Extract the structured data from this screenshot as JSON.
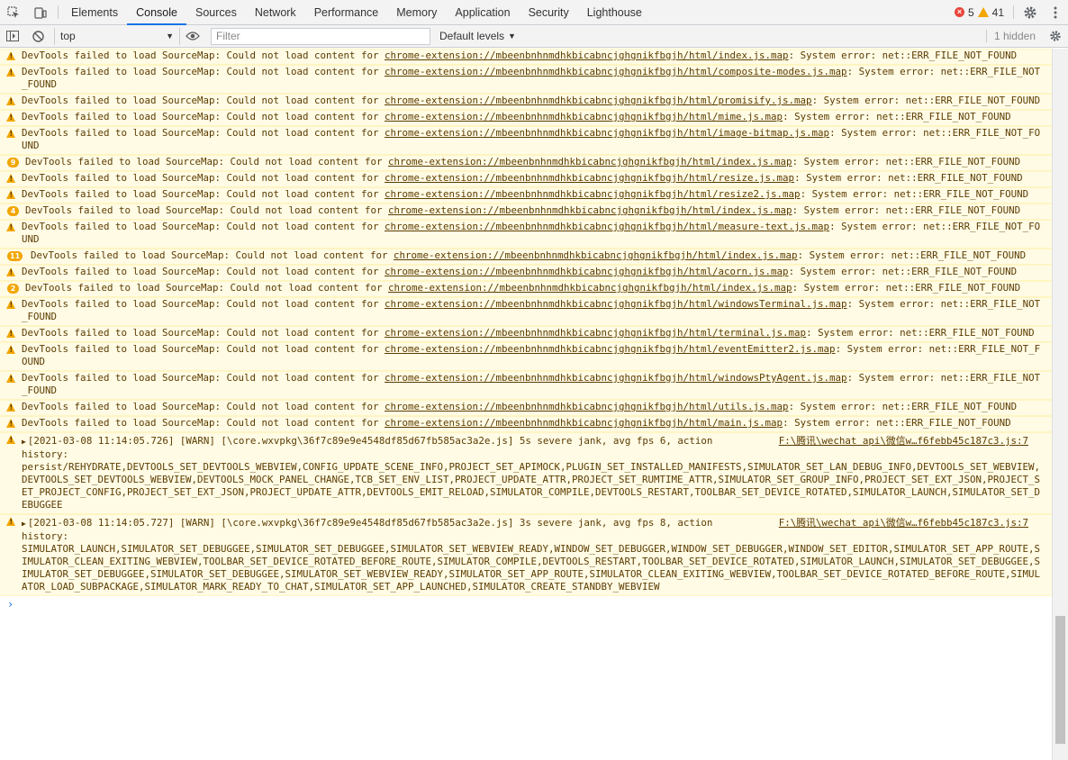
{
  "tabs": [
    "Elements",
    "Console",
    "Sources",
    "Network",
    "Performance",
    "Memory",
    "Application",
    "Security",
    "Lighthouse"
  ],
  "active_tab": "Console",
  "counts": {
    "errors": "5",
    "warnings": "41"
  },
  "toolbar": {
    "context": "top",
    "filter_placeholder": "Filter",
    "levels": "Default levels",
    "hidden": "1 hidden"
  },
  "messages": [
    {
      "badge": "",
      "text": "DevTools failed to load SourceMap: Could not load content for ",
      "link": "chrome-extension://mbeenbnhnmdhkbicabncjghgnikfbgjh/html/index.js.map",
      "tail": ": System error: net::ERR_FILE_NOT_FOUND"
    },
    {
      "badge": "",
      "text": "DevTools failed to load SourceMap: Could not load content for ",
      "link": "chrome-extension://mbeenbnhnmdhkbicabncjghgnikfbgjh/html/composite-modes.js.map",
      "tail": ": System error: net::ERR_FILE_NOT_FOUND"
    },
    {
      "badge": "",
      "text": "DevTools failed to load SourceMap: Could not load content for ",
      "link": "chrome-extension://mbeenbnhnmdhkbicabncjghgnikfbgjh/html/promisify.js.map",
      "tail": ": System error: net::ERR_FILE_NOT_FOUND"
    },
    {
      "badge": "",
      "text": "DevTools failed to load SourceMap: Could not load content for ",
      "link": "chrome-extension://mbeenbnhnmdhkbicabncjghgnikfbgjh/html/mime.js.map",
      "tail": ": System error: net::ERR_FILE_NOT_FOUND"
    },
    {
      "badge": "",
      "text": "DevTools failed to load SourceMap: Could not load content for ",
      "link": "chrome-extension://mbeenbnhnmdhkbicabncjghgnikfbgjh/html/image-bitmap.js.map",
      "tail": ": System error: net::ERR_FILE_NOT_FOUND"
    },
    {
      "badge": "9",
      "text": "DevTools failed to load SourceMap: Could not load content for ",
      "link": "chrome-extension://mbeenbnhnmdhkbicabncjghgnikfbgjh/html/index.js.map",
      "tail": ": System error: net::ERR_FILE_NOT_FOUND"
    },
    {
      "badge": "",
      "text": "DevTools failed to load SourceMap: Could not load content for ",
      "link": "chrome-extension://mbeenbnhnmdhkbicabncjghgnikfbgjh/html/resize.js.map",
      "tail": ": System error: net::ERR_FILE_NOT_FOUND"
    },
    {
      "badge": "",
      "text": "DevTools failed to load SourceMap: Could not load content for ",
      "link": "chrome-extension://mbeenbnhnmdhkbicabncjghgnikfbgjh/html/resize2.js.map",
      "tail": ": System error: net::ERR_FILE_NOT_FOUND"
    },
    {
      "badge": "4",
      "text": "DevTools failed to load SourceMap: Could not load content for ",
      "link": "chrome-extension://mbeenbnhnmdhkbicabncjghgnikfbgjh/html/index.js.map",
      "tail": ": System error: net::ERR_FILE_NOT_FOUND"
    },
    {
      "badge": "",
      "text": "DevTools failed to load SourceMap: Could not load content for ",
      "link": "chrome-extension://mbeenbnhnmdhkbicabncjghgnikfbgjh/html/measure-text.js.map",
      "tail": ": System error: net::ERR_FILE_NOT_FOUND"
    },
    {
      "badge": "11",
      "text": "DevTools failed to load SourceMap: Could not load content for ",
      "link": "chrome-extension://mbeenbnhnmdhkbicabncjghgnikfbgjh/html/index.js.map",
      "tail": ": System error: net::ERR_FILE_NOT_FOUND"
    },
    {
      "badge": "",
      "text": "DevTools failed to load SourceMap: Could not load content for ",
      "link": "chrome-extension://mbeenbnhnmdhkbicabncjghgnikfbgjh/html/acorn.js.map",
      "tail": ": System error: net::ERR_FILE_NOT_FOUND"
    },
    {
      "badge": "2",
      "text": "DevTools failed to load SourceMap: Could not load content for ",
      "link": "chrome-extension://mbeenbnhnmdhkbicabncjghgnikfbgjh/html/index.js.map",
      "tail": ": System error: net::ERR_FILE_NOT_FOUND"
    },
    {
      "badge": "",
      "text": "DevTools failed to load SourceMap: Could not load content for ",
      "link": "chrome-extension://mbeenbnhnmdhkbicabncjghgnikfbgjh/html/windowsTerminal.js.map",
      "tail": ": System error: net::ERR_FILE_NOT_FOUND"
    },
    {
      "badge": "",
      "text": "DevTools failed to load SourceMap: Could not load content for ",
      "link": "chrome-extension://mbeenbnhnmdhkbicabncjghgnikfbgjh/html/terminal.js.map",
      "tail": ": System error: net::ERR_FILE_NOT_FOUND"
    },
    {
      "badge": "",
      "text": "DevTools failed to load SourceMap: Could not load content for ",
      "link": "chrome-extension://mbeenbnhnmdhkbicabncjghgnikfbgjh/html/eventEmitter2.js.map",
      "tail": ": System error: net::ERR_FILE_NOT_FOUND"
    },
    {
      "badge": "",
      "text": "DevTools failed to load SourceMap: Could not load content for ",
      "link": "chrome-extension://mbeenbnhnmdhkbicabncjghgnikfbgjh/html/windowsPtyAgent.js.map",
      "tail": ": System error: net::ERR_FILE_NOT_FOUND"
    },
    {
      "badge": "",
      "text": "DevTools failed to load SourceMap: Could not load content for ",
      "link": "chrome-extension://mbeenbnhnmdhkbicabncjghgnikfbgjh/html/utils.js.map",
      "tail": ": System error: net::ERR_FILE_NOT_FOUND"
    },
    {
      "badge": "",
      "text": "DevTools failed to load SourceMap: Could not load content for ",
      "link": "chrome-extension://mbeenbnhnmdhkbicabncjghgnikfbgjh/html/main.js.map",
      "tail": ": System error: net::ERR_FILE_NOT_FOUND"
    }
  ],
  "jank": [
    {
      "header": "[2021-03-08 11:14:05.726] [WARN] [\\core.wxvpkg\\36f7c89e9e4548df85d67fb585ac3a2e.js] 5s severe jank, avg fps 6, action",
      "source": "F:\\腾讯\\wechat api\\微信w…f6febb45c187c3.js:7",
      "body": "history:\npersist/REHYDRATE,DEVTOOLS_SET_DEVTOOLS_WEBVIEW,CONFIG_UPDATE_SCENE_INFO,PROJECT_SET_APIMOCK,PLUGIN_SET_INSTALLED_MANIFESTS,SIMULATOR_SET_LAN_DEBUG_INFO,DEVTOOLS_SET_WEBVIEW,DEVTOOLS_SET_DEVTOOLS_WEBVIEW,DEVTOOLS_MOCK_PANEL_CHANGE,TCB_SET_ENV_LIST,PROJECT_UPDATE_ATTR,PROJECT_SET_RUMTIME_ATTR,SIMULATOR_SET_GROUP_INFO,PROJECT_SET_EXT_JSON,PROJECT_SET_PROJECT_CONFIG,PROJECT_SET_EXT_JSON,PROJECT_UPDATE_ATTR,DEVTOOLS_EMIT_RELOAD,SIMULATOR_COMPILE,DEVTOOLS_RESTART,TOOLBAR_SET_DEVICE_ROTATED,SIMULATOR_LAUNCH,SIMULATOR_SET_DEBUGGEE"
    },
    {
      "header": "[2021-03-08 11:14:05.727] [WARN] [\\core.wxvpkg\\36f7c89e9e4548df85d67fb585ac3a2e.js] 3s severe jank, avg fps 8, action",
      "source": "F:\\腾讯\\wechat api\\微信w…f6febb45c187c3.js:7",
      "body": "history:\nSIMULATOR_LAUNCH,SIMULATOR_SET_DEBUGGEE,SIMULATOR_SET_DEBUGGEE,SIMULATOR_SET_WEBVIEW_READY,WINDOW_SET_DEBUGGER,WINDOW_SET_DEBUGGER,WINDOW_SET_EDITOR,SIMULATOR_SET_APP_ROUTE,SIMULATOR_CLEAN_EXITING_WEBVIEW,TOOLBAR_SET_DEVICE_ROTATED_BEFORE_ROUTE,SIMULATOR_COMPILE,DEVTOOLS_RESTART,TOOLBAR_SET_DEVICE_ROTATED,SIMULATOR_LAUNCH,SIMULATOR_SET_DEBUGGEE,SIMULATOR_SET_DEBUGGEE,SIMULATOR_SET_DEBUGGEE,SIMULATOR_SET_WEBVIEW_READY,SIMULATOR_SET_APP_ROUTE,SIMULATOR_CLEAN_EXITING_WEBVIEW,TOOLBAR_SET_DEVICE_ROTATED_BEFORE_ROUTE,SIMULATOR_LOAD_SUBPACKAGE,SIMULATOR_MARK_READY_TO_CHAT,SIMULATOR_SET_APP_LAUNCHED,SIMULATOR_CREATE_STANDBY_WEBVIEW"
    }
  ],
  "prompt": "›"
}
